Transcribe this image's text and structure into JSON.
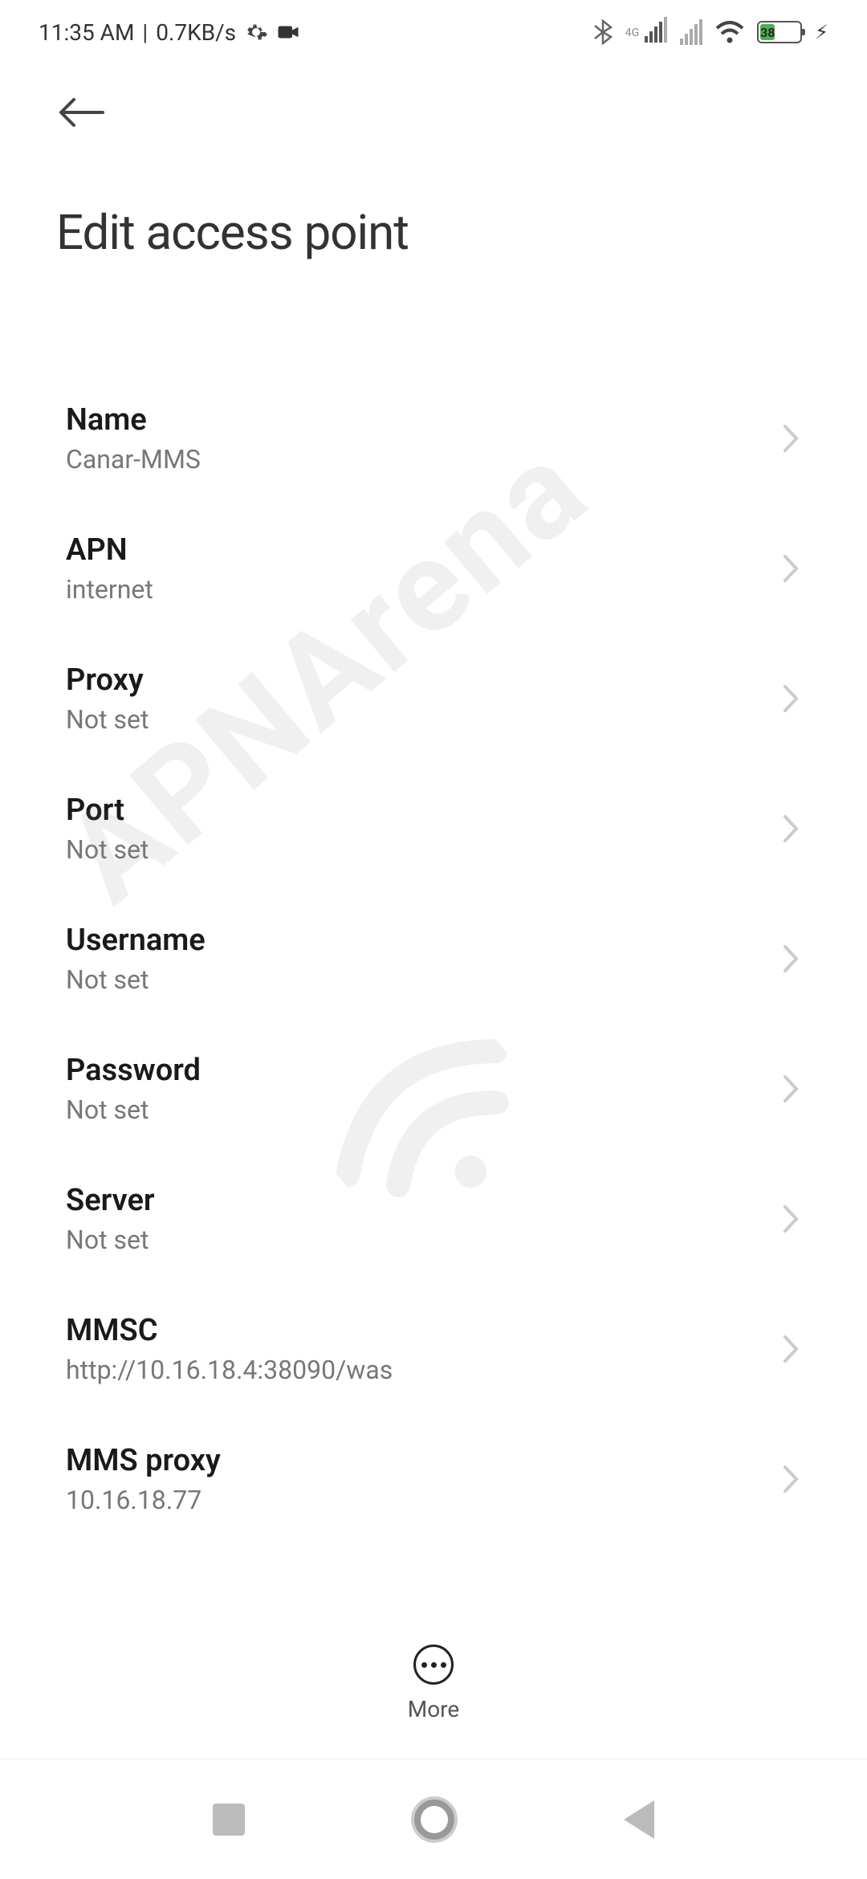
{
  "status": {
    "time": "11:35 AM",
    "data_speed": "0.7KB/s",
    "network_label_4g": "4G",
    "battery_pct": "38"
  },
  "header": {
    "title": "Edit access point"
  },
  "settings": [
    {
      "label": "Name",
      "value": "Canar-MMS"
    },
    {
      "label": "APN",
      "value": "internet"
    },
    {
      "label": "Proxy",
      "value": "Not set"
    },
    {
      "label": "Port",
      "value": "Not set"
    },
    {
      "label": "Username",
      "value": "Not set"
    },
    {
      "label": "Password",
      "value": "Not set"
    },
    {
      "label": "Server",
      "value": "Not set"
    },
    {
      "label": "MMSC",
      "value": "http://10.16.18.4:38090/was"
    },
    {
      "label": "MMS proxy",
      "value": "10.16.18.77"
    }
  ],
  "bottom": {
    "more_label": "More"
  },
  "watermark": {
    "text": "APNArena"
  }
}
